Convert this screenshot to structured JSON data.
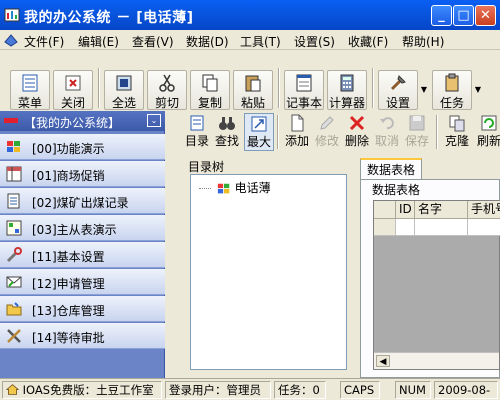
{
  "window": {
    "title": "我的办公系统 － [电话薄]"
  },
  "menu": [
    "文件(F)",
    "编辑(E)",
    "查看(V)",
    "数据(D)",
    "工具(T)",
    "设置(S)",
    "收藏(F)",
    "帮助(H)"
  ],
  "toolbar": {
    "menu": "菜单",
    "close": "关闭",
    "select_all": "全选",
    "cut": "剪切",
    "copy": "复制",
    "paste": "粘贴",
    "notepad": "记事本",
    "calculator": "计算器",
    "settings": "设置",
    "tasks": "任务"
  },
  "sidebar": {
    "title": "【我的办公系统】",
    "items": [
      {
        "label": "[00]功能演示"
      },
      {
        "label": "[01]商场促销"
      },
      {
        "label": "[02]煤矿出煤记录"
      },
      {
        "label": "[03]主从表演示"
      },
      {
        "label": "[11]基本设置"
      },
      {
        "label": "[12]申请管理"
      },
      {
        "label": "[13]仓库管理"
      },
      {
        "label": "[14]等待审批"
      }
    ]
  },
  "main_toolbar": {
    "catalog": "目录",
    "find": "查找",
    "maximize": "最大",
    "add": "添加",
    "modify": "修改",
    "delete": "删除",
    "cancel": "取消",
    "save": "保存",
    "clone": "克隆",
    "refresh": "刷新"
  },
  "tree": {
    "label": "目录树",
    "node": "电话薄"
  },
  "tab": {
    "label": "数据表格"
  },
  "grid": {
    "group_label": "数据表格",
    "columns": [
      "",
      "ID",
      "名字",
      "手机号"
    ]
  },
  "status": {
    "edition": "IOAS免费版：土豆工作室",
    "user": "登录用户：管理员",
    "tasks": "任务：0",
    "caps": "CAPS",
    "num": "NUM",
    "date": "2009-08-"
  }
}
